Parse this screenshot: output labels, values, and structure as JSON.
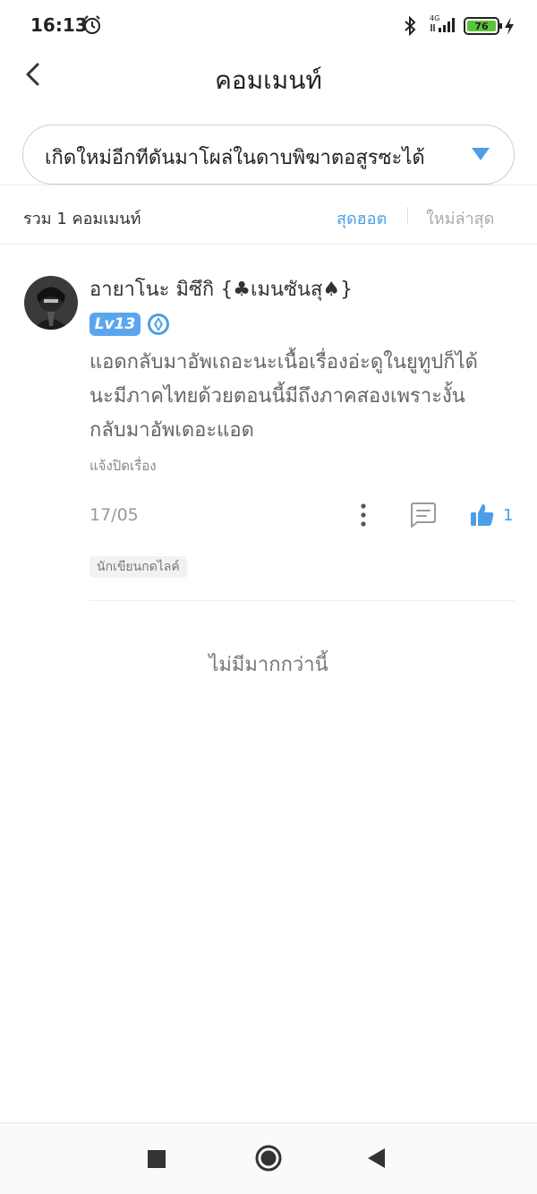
{
  "status_bar": {
    "time": "16:13",
    "network_label": "4G",
    "battery": "76",
    "icons": [
      "alarm-icon",
      "bluetooth-icon",
      "signal-icon",
      "battery-icon",
      "charging-icon"
    ]
  },
  "header": {
    "title": "คอมเมนท์",
    "back_icon": "chevron-left-icon"
  },
  "chapter_selector": {
    "selected": "เกิดใหม่อีกทีดันมาโผล่ในดาบพิฆาตอสูรซะได้",
    "arrow_icon": "triangle-down-icon"
  },
  "summary": {
    "count_label": "รวม 1 คอมเมนท์",
    "sort_options": [
      "สุดฮอต",
      "ใหม่ล่าสุด"
    ],
    "active_sort": "สุดฮอต"
  },
  "comment": {
    "username": "อายาโนะ มิซึกิ {♣เมนซันสุ♠}",
    "level": "Lv13",
    "text_lines": [
      "แอดกลับมาอัพเถอะนะเนื้อเรื่องอ่ะดูในยูทูปก็ได้",
      "นะมีภาคไทยด้วยตอนนี้มีถึงภาคสองเพราะงั้น",
      "กลับมาอัพเดอะแอด"
    ],
    "report_label": "แจ้งปิดเรื่อง",
    "date": "17/05",
    "like_count": "1",
    "author_tag": "นักเขียนกดไลค์"
  },
  "footer_text": "ไม่มีมากกว่านี้",
  "accent_color": "#4a9fe6"
}
